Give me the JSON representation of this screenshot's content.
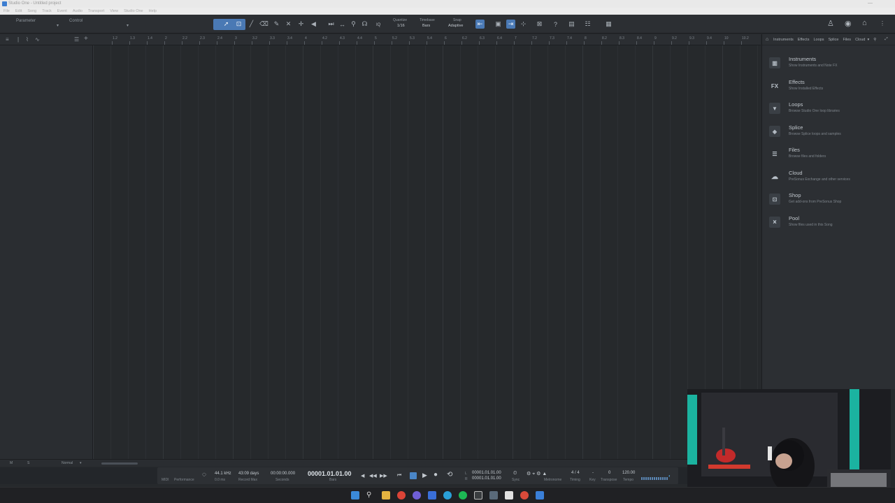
{
  "window": {
    "title": "Studio One - Untitled project"
  },
  "menubar": [
    "File",
    "Edit",
    "Song",
    "Track",
    "Event",
    "Audio",
    "Transport",
    "View",
    "Studio One",
    "Help"
  ],
  "toolbar": {
    "parameter_label": "Parameter",
    "control_label": "Control",
    "quantize_label": "Quantize",
    "quantize_value": "1/16",
    "timebase_label": "Timebase",
    "timebase_value": "Bars",
    "snap_label": "Snap",
    "snap_value": "Adaptive",
    "iq_label": "IQ"
  },
  "ruler": {
    "labels": [
      "1.2",
      "1.3",
      "1.4",
      "2",
      "2.2",
      "2.3",
      "2.4",
      "3",
      "3.2",
      "3.3",
      "3.4",
      "4",
      "4.2",
      "4.3",
      "4.4",
      "5",
      "5.2",
      "5.3",
      "5.4",
      "6",
      "6.2",
      "6.3",
      "6.4",
      "7",
      "7.2",
      "7.3",
      "7.4",
      "8",
      "8.2",
      "8.3",
      "8.4",
      "9",
      "9.2",
      "9.3",
      "9.4",
      "10",
      "10.2"
    ]
  },
  "browser": {
    "tabs": [
      "Instruments",
      "Effects",
      "Loops",
      "Splice",
      "Files",
      "Cloud"
    ],
    "items": [
      {
        "title": "Instruments",
        "desc": "Show Instruments and Note FX",
        "icon": "keyboard-icon"
      },
      {
        "title": "Effects",
        "desc": "Show Installed Effects",
        "icon": "fx-icon"
      },
      {
        "title": "Loops",
        "desc": "Browse Studio One loop libraries",
        "icon": "loops-icon"
      },
      {
        "title": "Splice",
        "desc": "Browse Splice loops and samples",
        "icon": "splice-icon"
      },
      {
        "title": "Files",
        "desc": "Browse files and folders",
        "icon": "files-icon"
      },
      {
        "title": "Cloud",
        "desc": "PreSonus Exchange and other services",
        "icon": "cloud-icon"
      },
      {
        "title": "Shop",
        "desc": "Get add-ons from PreSonus Shop",
        "icon": "shop-icon"
      },
      {
        "title": "Pool",
        "desc": "Show files used in this Song",
        "icon": "pool-icon"
      }
    ]
  },
  "bottomstrip": {
    "m": "M",
    "s": "S",
    "mode": "Normal"
  },
  "transport": {
    "midi": "MIDI",
    "performance": "Performance",
    "sample_rate": "44.1 kHz",
    "latency": "0.0 ms",
    "record_max_value": "43:09 days",
    "record_max_label": "Record Max",
    "seconds_value": "00:00:00.000",
    "seconds_label": "Seconds",
    "position": "00001.01.01.00",
    "position_unit": "Bars",
    "loop_l": "00001.01.01.00",
    "loop_r": "00001.01.01.00",
    "l": "L",
    "r": "R",
    "sync": "Sync",
    "metronome": "Metronome",
    "timing_value": "4 / 4",
    "timing_label": "Timing",
    "key_value": "-",
    "key_label": "Key",
    "transpose_value": "0",
    "transpose_label": "Transpose",
    "tempo_value": "120.00",
    "tempo_label": "Tempo"
  },
  "colors": {
    "accent": "#4a79b4",
    "background": "#26292c",
    "panel": "#2c2f33"
  }
}
